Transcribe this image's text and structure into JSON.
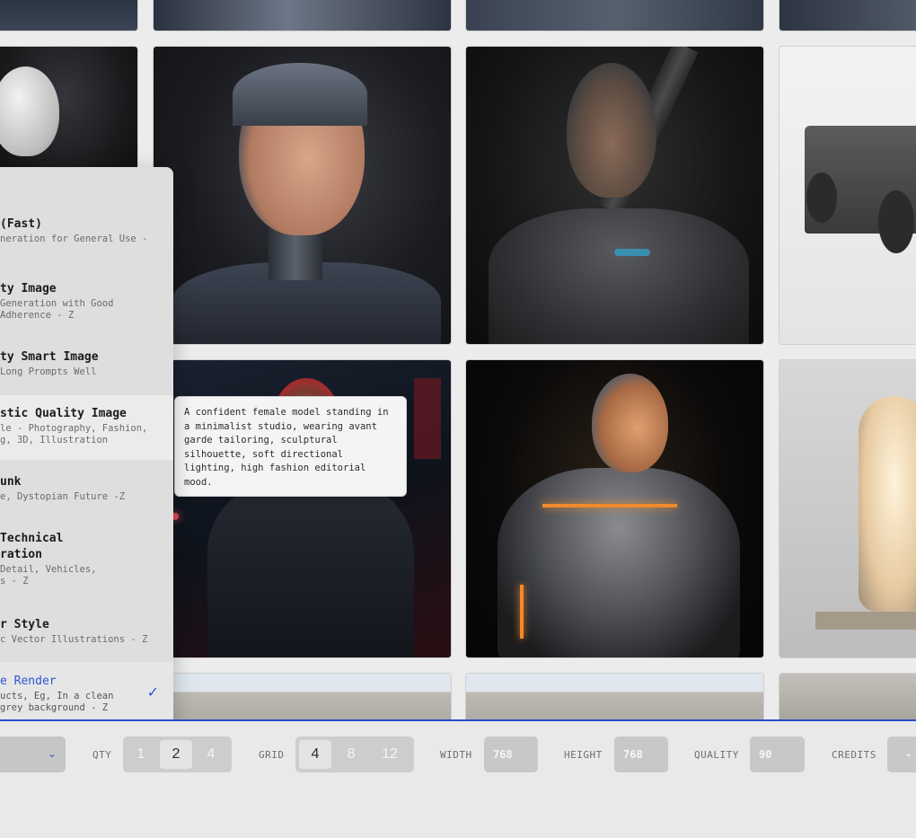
{
  "dropdown": {
    "items": [
      {
        "title": "(Fast)",
        "desc": [
          "neration for General Use -"
        ]
      },
      {
        "title": "ty Image",
        "desc": [
          "Generation with Good",
          "Adherence - Z"
        ]
      },
      {
        "title": "ty Smart Image",
        "desc": [
          "Long Prompts Well"
        ]
      },
      {
        "title": "stic Quality Image",
        "desc": [
          "le - Photography, Fashion,",
          "g, 3D, Illustration"
        ]
      },
      {
        "title": "unk",
        "desc": [
          "e, Dystopian Future -Z"
        ]
      },
      {
        "title": "Technical",
        "title2": "ration",
        "desc": [
          "Detail, Vehicles,",
          "s - Z"
        ]
      },
      {
        "title": "r Style",
        "desc": [
          "c Vector Illustrations - Z"
        ]
      },
      {
        "title": "e Render",
        "desc": [
          "ucts, Eg, In a clean",
          "grey background - Z"
        ],
        "selected": true
      }
    ],
    "check": "✓"
  },
  "tooltip": {
    "text": "A confident female model standing in a minimalist studio, wearing avant garde tailoring, sculptural silhouette, soft directional lighting, high fashion editorial mood."
  },
  "toolbar": {
    "model_chevron": "⌄",
    "qty": {
      "label": "QTY",
      "options": [
        "1",
        "2",
        "4"
      ],
      "selected": "2"
    },
    "grid": {
      "label": "GRID",
      "options": [
        "4",
        "8",
        "12"
      ],
      "selected": "4"
    },
    "width": {
      "label": "WIDTH",
      "value": "768"
    },
    "height": {
      "label": "HEIGHT",
      "value": "768"
    },
    "quality": {
      "label": "QUALITY",
      "value": "90"
    },
    "credits": {
      "label": "CREDITS",
      "value": "-"
    }
  },
  "colors": {
    "accent": "#2f55d4",
    "bottom_rule": "#2b4bc8",
    "panel": "#dedede",
    "toolbar_bg": "#e9e9e9"
  },
  "gallery": {
    "tiles": [
      {
        "name": "tile-cyborg-partial-top-left"
      },
      {
        "name": "tile-cyborg-top-2"
      },
      {
        "name": "tile-cyborg-top-3"
      },
      {
        "name": "tile-cyborg-top-4"
      },
      {
        "name": "tile-white-head"
      },
      {
        "name": "tile-cyborg-man"
      },
      {
        "name": "tile-armored-cyborg"
      },
      {
        "name": "tile-armored-truck"
      },
      {
        "name": "tile-red-hair-cyberpunk"
      },
      {
        "name": "tile-glowing-android"
      },
      {
        "name": "tile-capsule-pod"
      },
      {
        "name": "tile-concrete-1"
      },
      {
        "name": "tile-concrete-2"
      },
      {
        "name": "tile-concrete-3"
      }
    ]
  }
}
